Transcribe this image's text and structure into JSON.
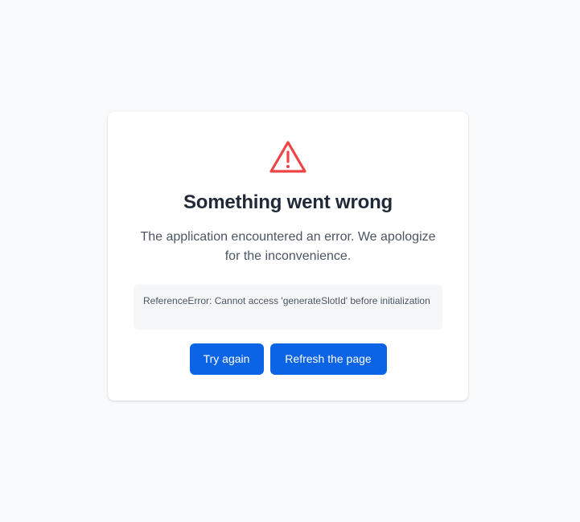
{
  "error_page": {
    "icon": "alert-triangle-icon",
    "title": "Something went wrong",
    "message": "The application encountered an error. We apologize for the inconvenience.",
    "error_detail": "ReferenceError: Cannot access 'generateSlotId' before initialization",
    "buttons": {
      "try_again": "Try again",
      "refresh": "Refresh the page"
    }
  },
  "colors": {
    "background": "#f8f9fb",
    "card": "#ffffff",
    "accent": "#0b63e5",
    "warning": "#ef4444",
    "title": "#1f2937",
    "text": "#4b5563",
    "error_box": "#f5f6f8"
  }
}
